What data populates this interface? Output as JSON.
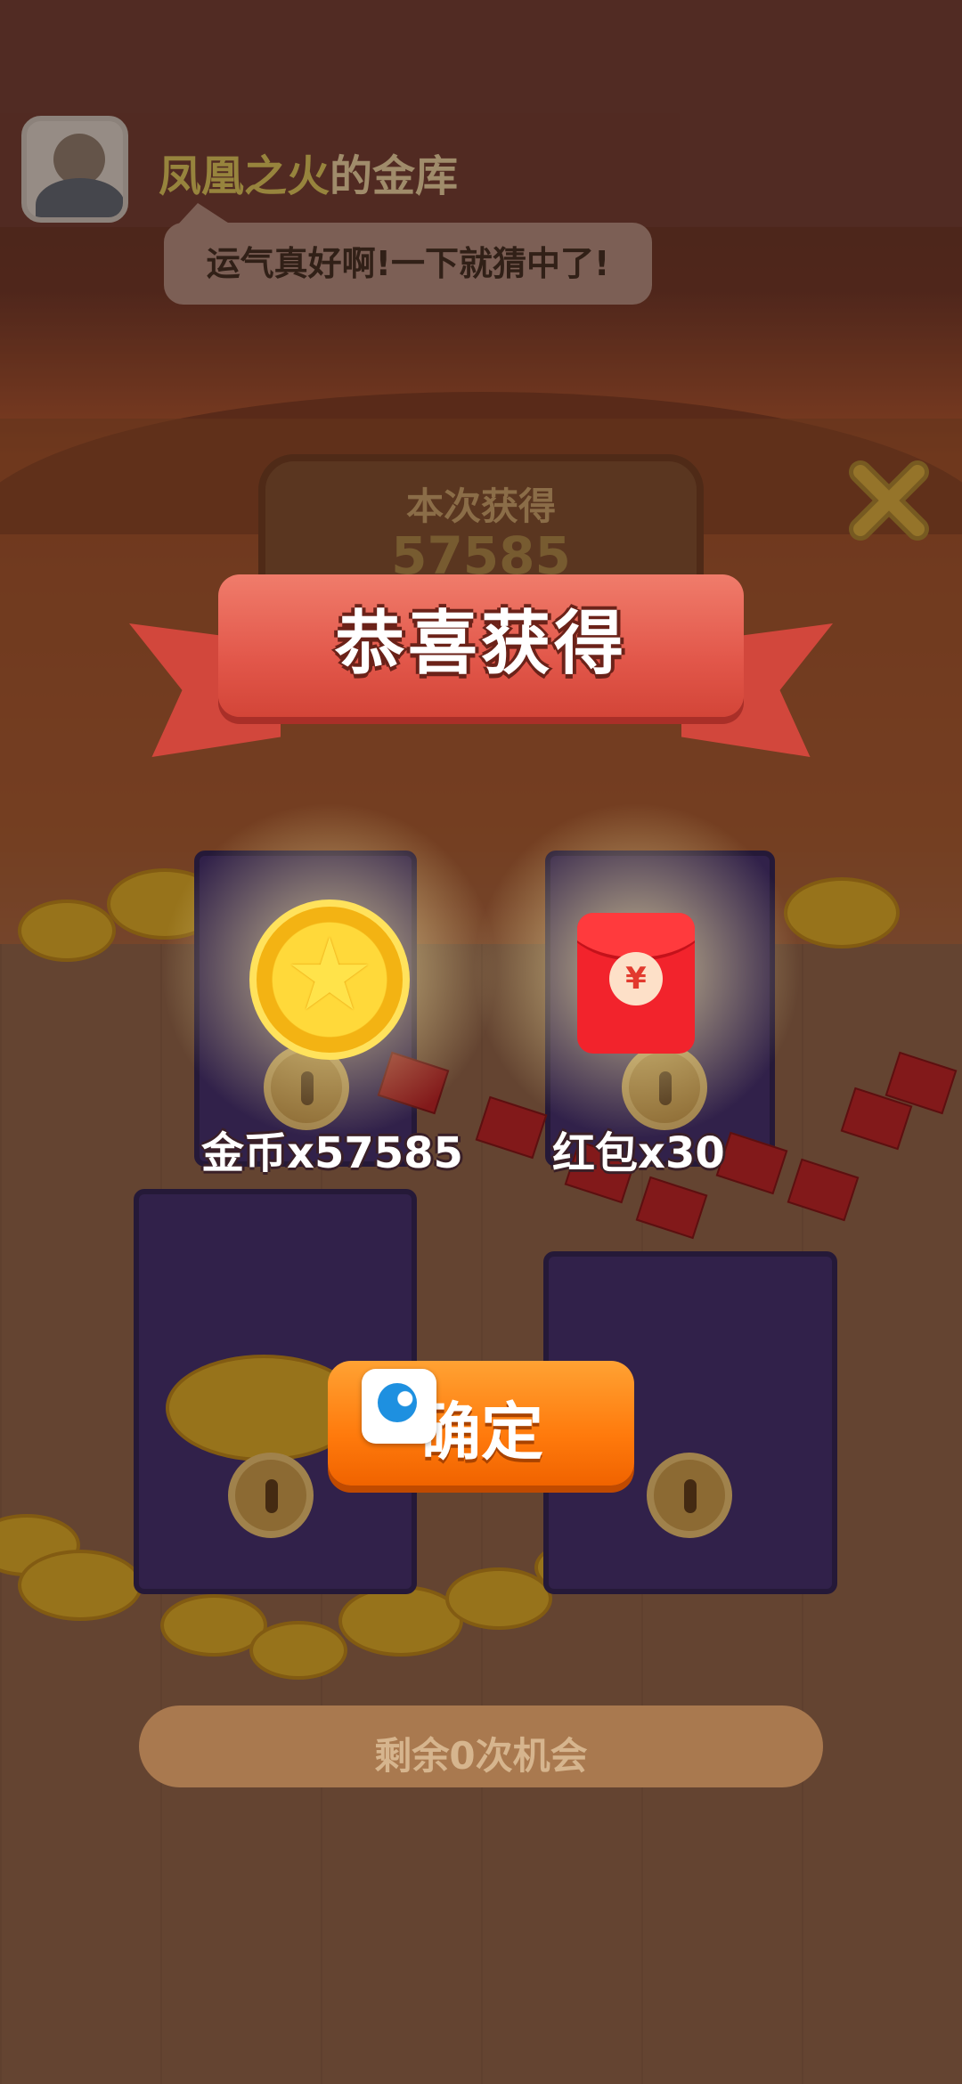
{
  "header": {
    "owner_name": "凤凰之火",
    "title_suffix": "的金库",
    "chat_bubble": "运气真好啊!一下就猜中了!"
  },
  "board": {
    "label": "本次获得",
    "value": "57585"
  },
  "banner": {
    "title": "恭喜获得"
  },
  "rewards": [
    {
      "label": "金币x57585",
      "icon": "gold-star-coin-icon"
    },
    {
      "label": "红包x30",
      "icon": "red-envelope-icon",
      "symbol": "¥"
    }
  ],
  "dialog": {
    "confirm_label": "确定"
  },
  "footer": {
    "remaining": "剩余0次机会"
  },
  "icons": {
    "close": "close-x-icon",
    "overlay": "app-logo-icon"
  },
  "colors": {
    "banner_red": "#e2574a",
    "confirm_orange": "#ff7a0c",
    "chest_purple": "#3d2c6e",
    "coin_gold": "#ffd93a"
  }
}
